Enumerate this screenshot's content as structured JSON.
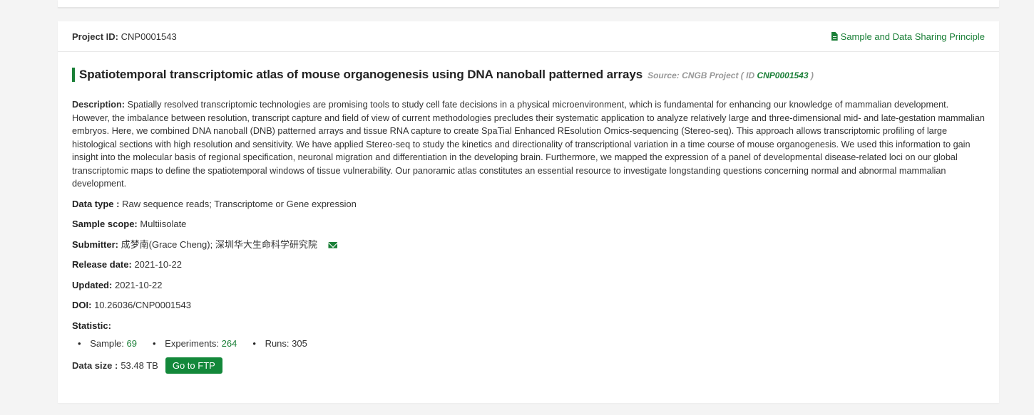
{
  "project": {
    "id_label": "Project ID:",
    "id_value": "CNP0001543",
    "share_link": "Sample and Data Sharing Principle"
  },
  "title": {
    "text": "Spatiotemporal transcriptomic atlas of mouse organogenesis using DNA nanoball patterned arrays",
    "source_prefix": "Source:  CNGB Project  ( ID",
    "source_id": "CNP0001543",
    "source_suffix": ")"
  },
  "description": {
    "label": "Description:",
    "text": "Spatially resolved transcriptomic technologies are promising tools to study cell fate decisions in a physical microenvironment, which is fundamental for enhancing our knowledge of mammalian development. However, the imbalance between resolution, transcript capture and field of view of current methodologies precludes their systematic application to analyze relatively large and three-dimensional mid- and late-gestation mammalian embryos. Here, we combined DNA nanoball (DNB) patterned arrays and tissue RNA capture to create SpaTial Enhanced REsolution Omics-sequencing (Stereo-seq). This approach allows transcriptomic profiling of large histological sections with high resolution and sensitivity. We have applied Stereo-seq to study the kinetics and directionality of transcriptional variation in a time course of mouse organogenesis. We used this information to gain insight into the molecular basis of regional specification, neuronal migration and differentiation in the developing brain. Furthermore, we mapped the expression of a panel of developmental disease-related loci on our global transcriptomic maps to define the spatiotemporal windows of tissue vulnerability. Our panoramic atlas constitutes an essential resource to investigate longstanding questions concerning normal and abnormal mammalian development."
  },
  "fields": {
    "data_type_label": "Data type :",
    "data_type_value": "Raw sequence reads;  Transcriptome or Gene expression",
    "sample_scope_label": "Sample scope:",
    "sample_scope_value": "Multiisolate",
    "submitter_label": "Submitter:",
    "submitter_value": "成梦南(Grace Cheng); 深圳华大生命科学研究院",
    "release_label": "Release date:",
    "release_value": "2021-10-22",
    "updated_label": "Updated:",
    "updated_value": "2021-10-22",
    "doi_label": "DOI:",
    "doi_value": "10.26036/CNP0001543",
    "statistic_label": "Statistic:"
  },
  "statistics": {
    "sample_label": "Sample:",
    "sample_value": "69",
    "experiments_label": "Experiments:",
    "experiments_value": "264",
    "runs_label": "Runs:",
    "runs_value": "305"
  },
  "data_size": {
    "label": "Data size :",
    "value": "53.48 TB",
    "ftp_button": "Go to FTP"
  },
  "icons": {
    "share": "file-text-icon",
    "submitter": "envelope-icon"
  },
  "colors": {
    "accent": "#1a7f37",
    "button": "#13883a"
  }
}
